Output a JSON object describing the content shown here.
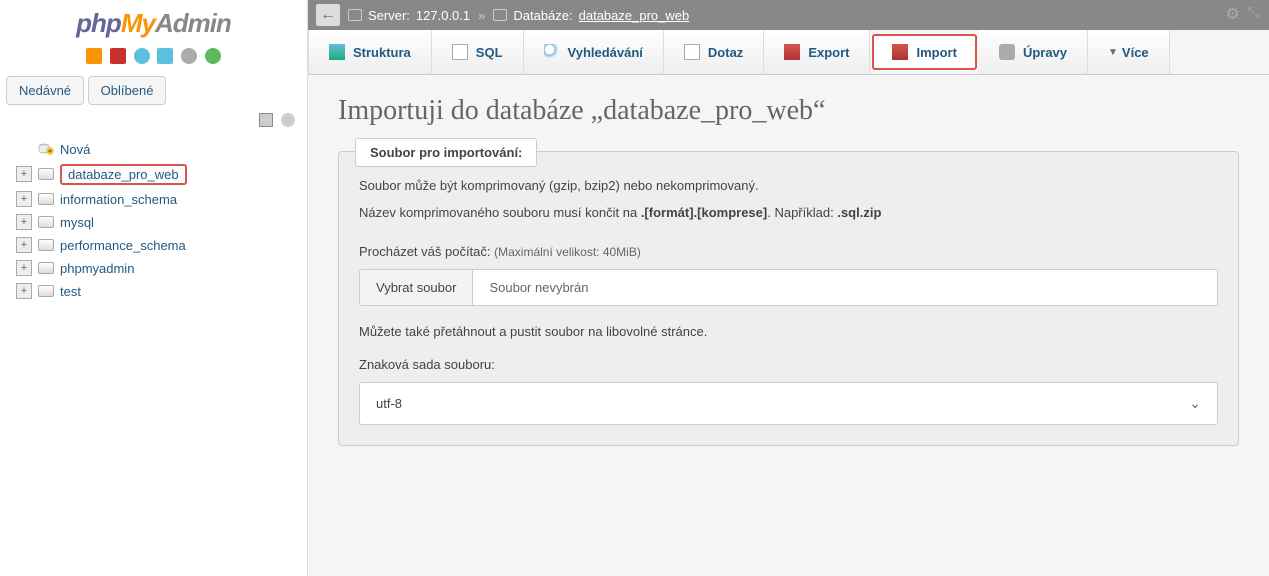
{
  "logo": {
    "php": "php",
    "my": "My",
    "admin": "Admin"
  },
  "sidebar": {
    "recent_label": "Nedávné",
    "favorites_label": "Oblíbené",
    "tree": [
      {
        "label": "Nová",
        "expandable": false,
        "is_new": true,
        "highlighted": false
      },
      {
        "label": "databaze_pro_web",
        "expandable": true,
        "expanded": false,
        "highlighted": true
      },
      {
        "label": "information_schema",
        "expandable": true,
        "expanded": false,
        "highlighted": false
      },
      {
        "label": "mysql",
        "expandable": true,
        "expanded": false,
        "highlighted": false
      },
      {
        "label": "performance_schema",
        "expandable": true,
        "expanded": false,
        "highlighted": false
      },
      {
        "label": "phpmyadmin",
        "expandable": true,
        "expanded": false,
        "highlighted": false
      },
      {
        "label": "test",
        "expandable": true,
        "expanded": false,
        "highlighted": false
      }
    ]
  },
  "breadcrumb": {
    "server_label": "Server:",
    "server_value": "127.0.0.1",
    "db_label": "Databáze:",
    "db_value": "databaze_pro_web"
  },
  "tabs": [
    {
      "key": "struktura",
      "label": "Struktura",
      "icon": "ic-struct",
      "active": false
    },
    {
      "key": "sql",
      "label": "SQL",
      "icon": "ic-sql",
      "active": false
    },
    {
      "key": "vyhledavani",
      "label": "Vyhledávání",
      "icon": "ic-search",
      "active": false
    },
    {
      "key": "dotaz",
      "label": "Dotaz",
      "icon": "ic-query",
      "active": false
    },
    {
      "key": "export",
      "label": "Export",
      "icon": "ic-export",
      "active": false
    },
    {
      "key": "import",
      "label": "Import",
      "icon": "ic-import",
      "active": true
    },
    {
      "key": "upravy",
      "label": "Úpravy",
      "icon": "ic-ops",
      "active": false
    },
    {
      "key": "vice",
      "label": "Více",
      "icon": "",
      "active": false,
      "dropdown": true
    }
  ],
  "page": {
    "heading": "Importuji do databáze „databaze_pro_web“",
    "fieldset_legend": "Soubor pro importování:",
    "desc_line1": "Soubor může být komprimovaný (gzip, bzip2) nebo nekomprimovaný.",
    "desc_line2_prefix": "Název komprimovaného souboru musí končit na ",
    "desc_line2_bold": ".[formát].[komprese]",
    "desc_line2_mid": ". Například: ",
    "desc_line2_bold2": ".sql.zip",
    "browse_label": "Procházet váš počítač:",
    "max_size": "(Maximální velikost: 40MiB)",
    "choose_file_btn": "Vybrat soubor",
    "no_file_selected": "Soubor nevybrán",
    "drag_hint": "Můžete také přetáhnout a pustit soubor na libovolné stránce.",
    "charset_label": "Znaková sada souboru:",
    "charset_value": "utf-8"
  }
}
